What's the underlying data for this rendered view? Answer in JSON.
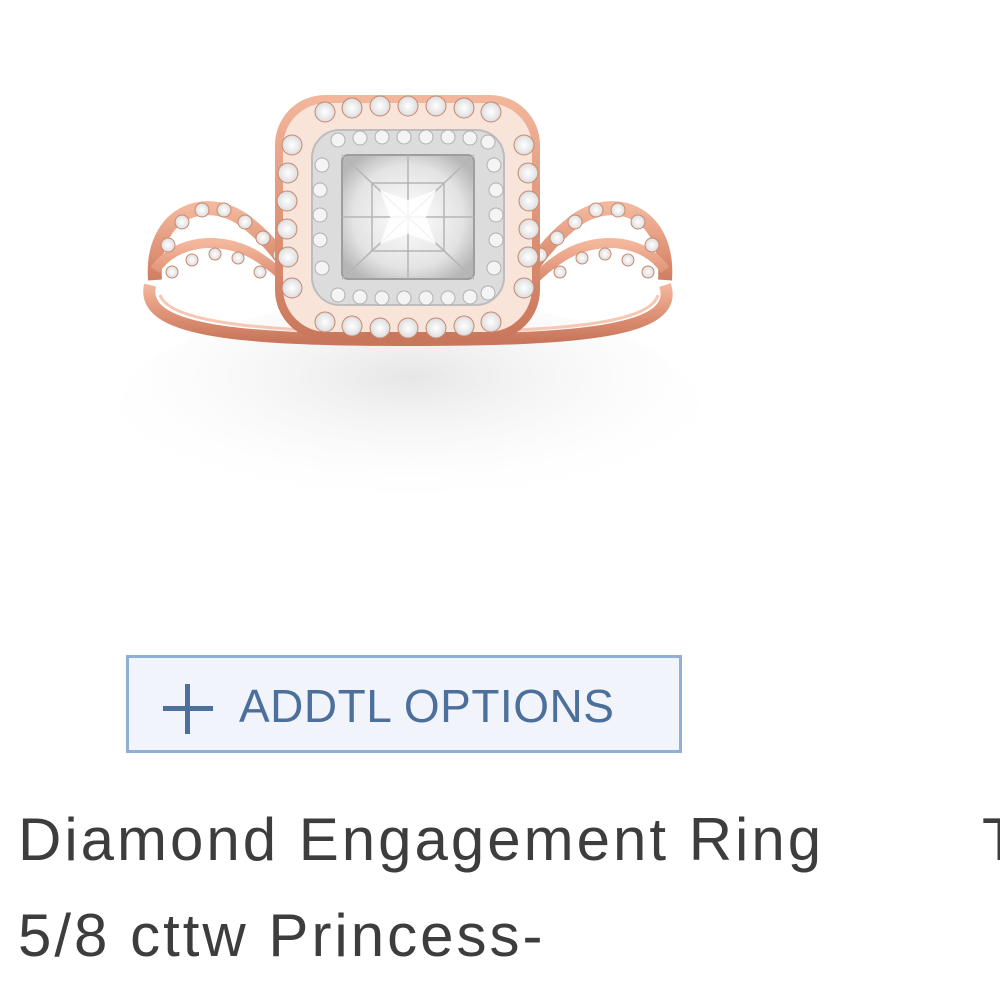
{
  "product": {
    "image_alt": "Rose gold princess-cut diamond halo engagement ring",
    "options_button_label": "ADDTL OPTIONS",
    "options_icon": "plus-icon",
    "title": "Diamond Engagement Ring 5/8 cttw Princess-"
  },
  "next_product": {
    "title_fragment": "T"
  },
  "colors": {
    "accent": "#4c6f9b",
    "button_border": "#8fb0d4",
    "button_background": "#f1f5fb",
    "title_text": "#3d3d3d"
  }
}
